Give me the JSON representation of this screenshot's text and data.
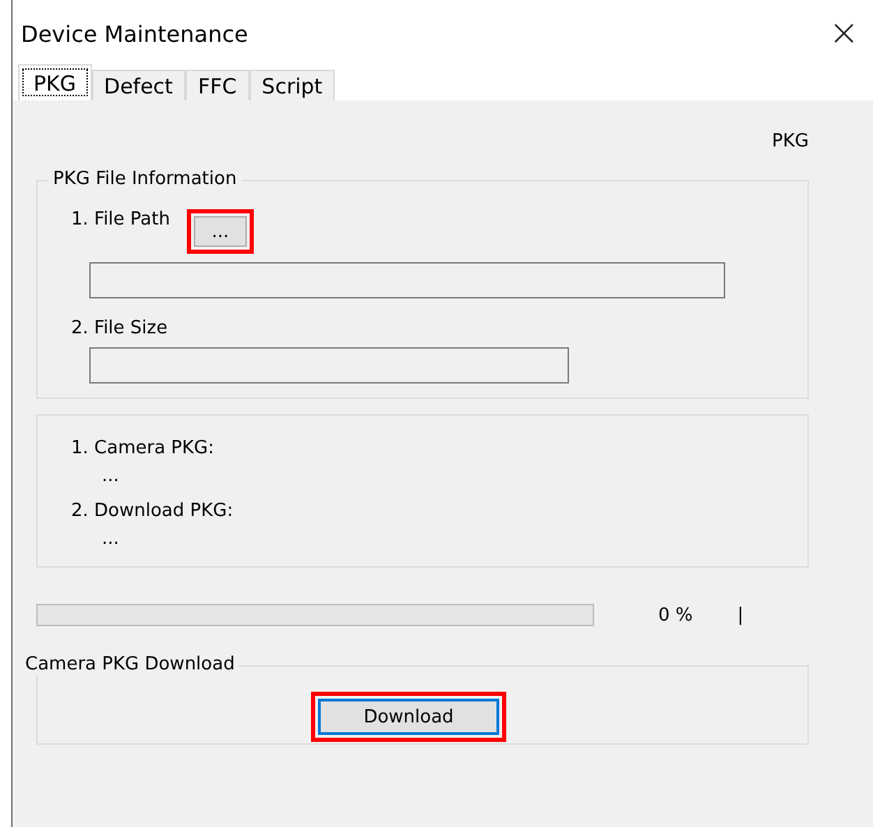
{
  "window": {
    "title": "Device Maintenance",
    "close": "×"
  },
  "tabs": [
    {
      "label": "PKG",
      "selected": true
    },
    {
      "label": "Defect",
      "selected": false
    },
    {
      "label": "FFC",
      "selected": false
    },
    {
      "label": "Script",
      "selected": false
    }
  ],
  "header_label": "PKG",
  "file_info": {
    "title": "PKG File Information",
    "file_path_label": "1. File Path",
    "browse_button": {
      "label": "...",
      "highlighted": true
    },
    "file_size_label": "2. File Size"
  },
  "pkg_info": [
    {
      "label": "1. Camera PKG:",
      "value": "..."
    },
    {
      "label": "2. Download PKG:",
      "value": "..."
    }
  ],
  "progress": {
    "level": 0,
    "reading": "0 %",
    "status": "|"
  },
  "download": {
    "title": "Camera PKG Download",
    "button": {
      "label": "Download",
      "highlighted": true,
      "focused": true
    }
  }
}
